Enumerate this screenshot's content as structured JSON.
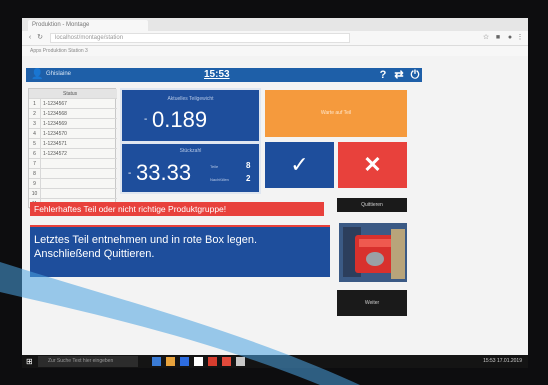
{
  "browser": {
    "tab_title": "Produktion - Montage",
    "url": "localhost/montage/station",
    "bookmarks": "Apps   Produktion   Station 3"
  },
  "header": {
    "user_name": "Ghislaine",
    "clock": "15:53"
  },
  "table": {
    "header": "Status",
    "rows": [
      {
        "n": "1",
        "t": "1-1234567"
      },
      {
        "n": "2",
        "t": "1-1234568"
      },
      {
        "n": "3",
        "t": "1-1234569"
      },
      {
        "n": "4",
        "t": "1-1234570"
      },
      {
        "n": "5",
        "t": "1-1234571"
      },
      {
        "n": "6",
        "t": "1-1234572"
      },
      {
        "n": "7",
        "t": ""
      },
      {
        "n": "8",
        "t": ""
      },
      {
        "n": "9",
        "t": ""
      },
      {
        "n": "10",
        "t": ""
      },
      {
        "n": "11",
        "t": ""
      }
    ]
  },
  "weight": {
    "label": "Aktuelles Teilgewicht",
    "prefix": "-",
    "value": "0.189"
  },
  "count": {
    "label": "Stückzahl",
    "prefix": "-",
    "value": "33.33",
    "stat1_label": "Teile",
    "stat1_value": "8",
    "stat2_label": "Nachfüllen",
    "stat2_value": "2"
  },
  "orange_panel": {
    "text": "Warte auf Teil"
  },
  "buttons": {
    "confirm": "✓",
    "cancel": "✕",
    "quit": "Quittieren",
    "next": "Weiter"
  },
  "error_text": "Fehlerhaftes Teil oder nicht richtige Produktgruppe!",
  "instruction_text": "Letztes Teil entnehmen und in rote Box legen. Anschließend Quittieren.",
  "taskbar": {
    "search_placeholder": "Zur Suche Text hier eingeben",
    "time": "15:53",
    "date": "17.01.2019"
  }
}
